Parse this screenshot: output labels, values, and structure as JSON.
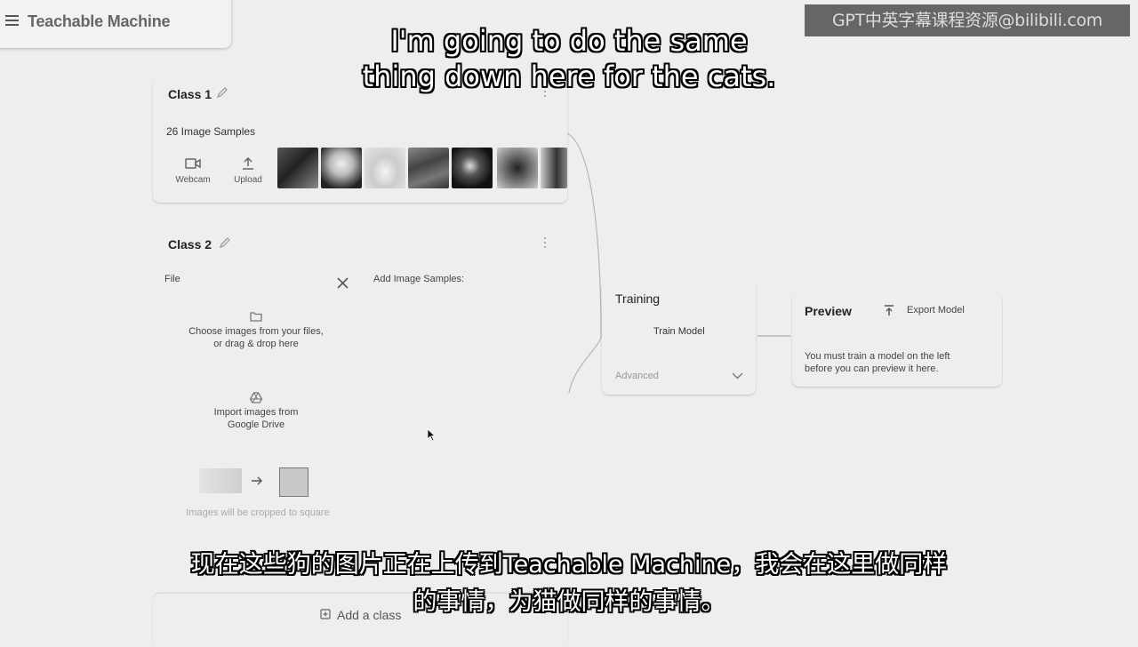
{
  "app": {
    "title": "Teachable Machine",
    "menu_icon": "hamburger-menu-icon"
  },
  "watermark": "GPT中英字幕课程资源@bilibili.com",
  "class1": {
    "title": "Class 1",
    "sample_count": "26 Image Samples",
    "webcam_label": "Webcam",
    "upload_label": "Upload",
    "thumbnails": [
      "dog-sample-1",
      "dog-sample-2",
      "dog-sample-3",
      "dog-sample-4",
      "dog-sample-5",
      "dog-sample-6",
      "dog-sample-7"
    ]
  },
  "class2": {
    "title": "Class 2",
    "file_label": "File",
    "add_samples_label": "Add Image Samples:",
    "choose_line1": "Choose images from your files,",
    "choose_line2": "or drag & drop here",
    "drive_line1": "Import images from",
    "drive_line2": "Google Drive",
    "crop_note": "Images will be cropped to square"
  },
  "add_class_label": "Add a class",
  "training": {
    "title": "Training",
    "train_button": "Train Model",
    "advanced_label": "Advanced"
  },
  "preview": {
    "title": "Preview",
    "export_button": "Export Model",
    "message_line1": "You must train a model on the left",
    "message_line2": "before you can preview it here."
  },
  "subtitles": {
    "english_line1": "I'm going to do the same",
    "english_line2": "thing down here for the cats.",
    "chinese_line1": "现在这些狗的图片正在上传到Teachable Machine，我会在这里做同样",
    "chinese_line2": "的事情，为猫做同样的事情。"
  },
  "colors": {
    "background": "#eeeeee",
    "text": "#2b2b2b",
    "muted": "#999999",
    "watermark_bg": "#666666"
  }
}
